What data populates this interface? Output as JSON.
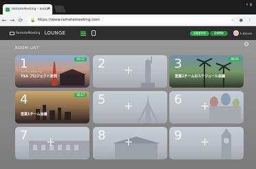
{
  "browser": {
    "tab_title": "RemoteMeeting - TeamMeeting",
    "tab_close": "×",
    "url": "https://www.remotemeeting.com",
    "lock_glyph": "🔒",
    "nav": {
      "back": "←",
      "forward": "→",
      "reload": "⟳"
    },
    "right_icons": {
      "star": "☆",
      "mic": "●",
      "menu": "⋮"
    }
  },
  "header": {
    "logo_text": "RemoteMeeting",
    "section": "LOUNGE",
    "pill1": "会議室作成",
    "pill2": "会議開始",
    "user_name": "k.kasuse"
  },
  "main": {
    "section_title": "ROOM LIST",
    "settings_glyph": "⚙"
  },
  "rooms": [
    {
      "number": "1",
      "sub": "ミーティングルーム",
      "name": "TSA プロジェクト定例",
      "timer": "00:12"
    },
    {
      "number": "2",
      "plus": "+"
    },
    {
      "number": "3",
      "sub": "",
      "name": "営業2チームのスケジュール会議",
      "timer": "00:45"
    },
    {
      "number": "4",
      "sub": "",
      "name": "営業1チーム会議",
      "timer": "00:27"
    },
    {
      "number": "5",
      "plus": "+"
    },
    {
      "number": "6",
      "plus": "+"
    },
    {
      "number": "7",
      "plus": "+"
    },
    {
      "number": "8",
      "plus": "+"
    },
    {
      "number": "9",
      "plus": "+"
    }
  ],
  "colors": {
    "accent": "#2eaa4f",
    "header_bg": "#2d2d2d",
    "main_bg": "#8a8a8a"
  }
}
